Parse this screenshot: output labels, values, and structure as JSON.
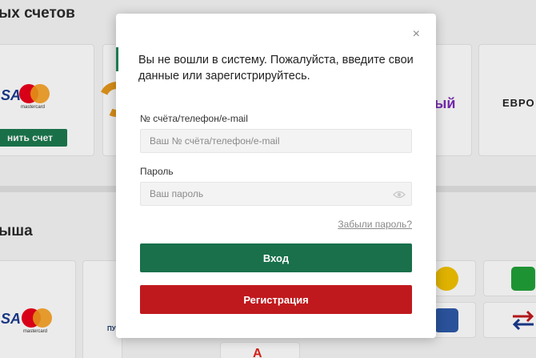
{
  "background": {
    "section_title_1": "ых счетов",
    "section_title_2": "ыша",
    "visa_label": "SA",
    "visa_label_2": "SA",
    "mastercard_label": "mastercard",
    "topup_button": "нить счет",
    "partial_logo_text": "ЕВРО",
    "partial_purple_text": "ый",
    "partial_lower_text": "ПУ"
  },
  "modal": {
    "message": "Вы не вошли в систему. Пожалуйста, введите свои данные или зарегистрируйтесь.",
    "account_label": "№ счёта/телефон/e-mail",
    "account_placeholder": "Ваш № счёта/телефон/e-mail",
    "password_label": "Пароль",
    "password_placeholder": "Ваш пароль",
    "forgot_link": "Забыли пароль?",
    "login_button": "Вход",
    "register_button": "Регистрация",
    "close_symbol": "×"
  },
  "colors": {
    "primary_green": "#19704b",
    "primary_red": "#c0191d"
  },
  "icons": [
    "close-icon",
    "eye-icon",
    "mastercard-logo",
    "visa-logo"
  ]
}
